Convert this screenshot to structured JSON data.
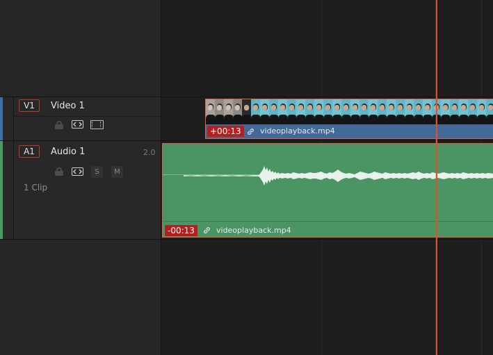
{
  "tracks": {
    "video": {
      "id": "V1",
      "name": "Video 1",
      "color": "#3f6fa6",
      "clip": {
        "offset": "+00:13",
        "filename": "videoplayback.mp4",
        "bar_color": "#41699a"
      }
    },
    "audio": {
      "id": "A1",
      "name": "Audio 1",
      "channels": "2.0",
      "clip_count": "1 Clip",
      "color": "#4a9a63",
      "solo_label": "S",
      "mute_label": "M",
      "clip": {
        "offset": "-00:13",
        "filename": "videoplayback.mp4",
        "fill_color": "#4b9564"
      }
    }
  },
  "colors": {
    "playhead": "#d8542f",
    "clip_border": "#e0603f",
    "timecode_badge": "#b3201d"
  },
  "icons": [
    "lock-icon",
    "sync-lock-icon",
    "film-strip-icon",
    "link-icon"
  ]
}
